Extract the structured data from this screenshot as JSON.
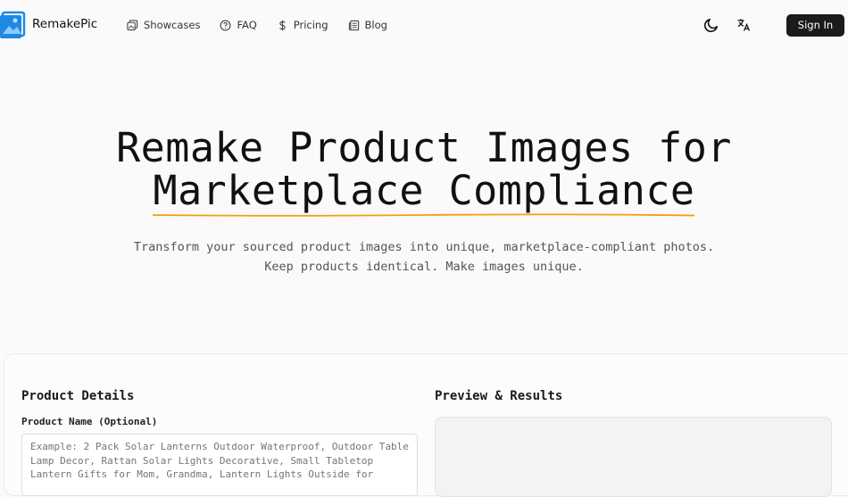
{
  "brand": {
    "name": "RemakePic",
    "accent": "#1e88e5"
  },
  "nav": {
    "items": [
      {
        "label": "Showcases",
        "icon": "gallery-icon"
      },
      {
        "label": "FAQ",
        "icon": "question-circle-icon"
      },
      {
        "label": "Pricing",
        "icon": "dollar-icon"
      },
      {
        "label": "Blog",
        "icon": "newspaper-icon"
      }
    ]
  },
  "toolbar": {
    "theme_icon": "moon-icon",
    "language_icon": "translate-icon",
    "signin_label": "Sign In"
  },
  "hero": {
    "title_line1": "Remake Product Images for",
    "title_line2": "Marketplace Compliance",
    "underline_color": "#f59e0b",
    "subtitle_line1": "Transform your sourced product images into unique, marketplace-compliant photos.",
    "subtitle_line2": "Keep products identical. Make images unique."
  },
  "form": {
    "title": "Product Details",
    "product_name_label": "Product Name (Optional)",
    "product_name_placeholder": "Example: 2 Pack Solar Lanterns Outdoor Waterproof, Outdoor Table Lamp Decor, Rattan Solar Lights Decorative, Small Tabletop Lantern Gifts for Mom, Grandma, Lantern Lights Outside for"
  },
  "preview": {
    "title": "Preview & Results"
  }
}
